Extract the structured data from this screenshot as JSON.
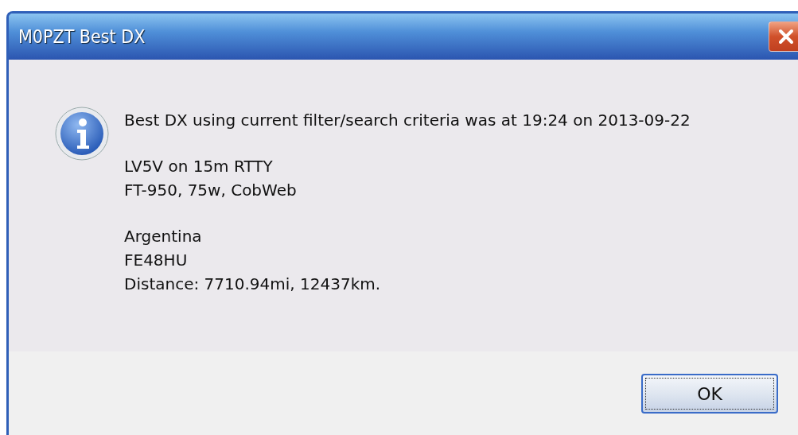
{
  "window": {
    "title": "M0PZT Best DX"
  },
  "message": {
    "paragraphs": [
      {
        "lines": [
          "Best DX using current filter/search criteria was at 19:24 on 2013-09-22"
        ]
      },
      {
        "lines": [
          "LV5V on 15m RTTY",
          "FT-950, 75w, CobWeb"
        ]
      },
      {
        "lines": [
          "Argentina",
          "FE48HU",
          "Distance: 7710.94mi, 12437km."
        ]
      }
    ]
  },
  "buttons": [
    {
      "label": "OK",
      "default": true
    }
  ]
}
